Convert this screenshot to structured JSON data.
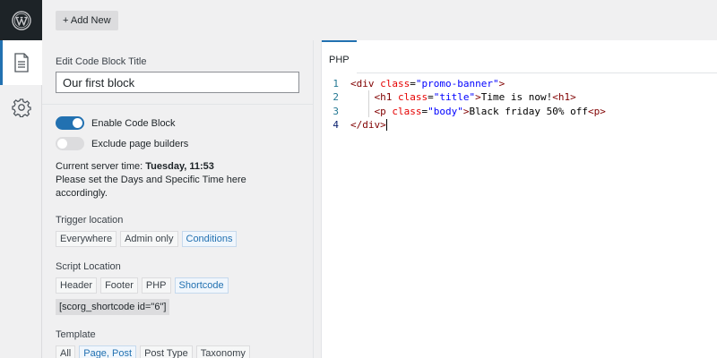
{
  "topbar": {
    "add_new_label": "+ Add New"
  },
  "sidebar": {
    "icons": [
      "wordpress-logo",
      "document-icon",
      "gear-icon"
    ]
  },
  "panel": {
    "title_label": "Edit Code Block Title",
    "title_value": "Our first block",
    "toggles": [
      {
        "label": "Enable Code Block",
        "on": true
      },
      {
        "label": "Exclude page builders",
        "on": false
      }
    ],
    "server_prefix": "Current server time: ",
    "server_time": "Tuesday, 11:53",
    "server_note": "Please set the Days and Specific Time here accordingly.",
    "trigger": {
      "title": "Trigger location",
      "options": [
        "Everywhere",
        "Admin only",
        "Conditions"
      ],
      "selected": "Conditions"
    },
    "script": {
      "title": "Script Location",
      "options": [
        "Header",
        "Footer",
        "PHP",
        "Shortcode"
      ],
      "selected": "Shortcode"
    },
    "shortcode": "[scorg_shortcode id=\"6\"]",
    "template": {
      "title": "Template",
      "options": [
        "All",
        "Page, Post",
        "Post Type",
        "Taxonomy"
      ],
      "selected": "Page, Post"
    }
  },
  "editor": {
    "tab_label": "PHP",
    "lines": [
      {
        "n": "1",
        "tokens": [
          [
            "tag",
            "<div "
          ],
          [
            "attr",
            "class"
          ],
          [
            "text",
            "="
          ],
          [
            "str",
            "\"promo-banner\""
          ],
          [
            "tag",
            ">"
          ]
        ]
      },
      {
        "n": "2",
        "tokens": [
          [
            "text",
            "    "
          ],
          [
            "tag",
            "<h1 "
          ],
          [
            "attr",
            "class"
          ],
          [
            "text",
            "="
          ],
          [
            "str",
            "\"title\""
          ],
          [
            "tag",
            ">"
          ],
          [
            "text",
            "Time is now!"
          ],
          [
            "tag",
            "<h1>"
          ]
        ]
      },
      {
        "n": "3",
        "tokens": [
          [
            "text",
            "    "
          ],
          [
            "tag",
            "<p "
          ],
          [
            "attr",
            "class"
          ],
          [
            "text",
            "="
          ],
          [
            "str",
            "\"body\""
          ],
          [
            "tag",
            ">"
          ],
          [
            "text",
            "Black friday 50% off"
          ],
          [
            "tag",
            "<p>"
          ]
        ]
      },
      {
        "n": "4",
        "tokens": [
          [
            "tag",
            "</div>"
          ]
        ],
        "current": true
      }
    ]
  }
}
